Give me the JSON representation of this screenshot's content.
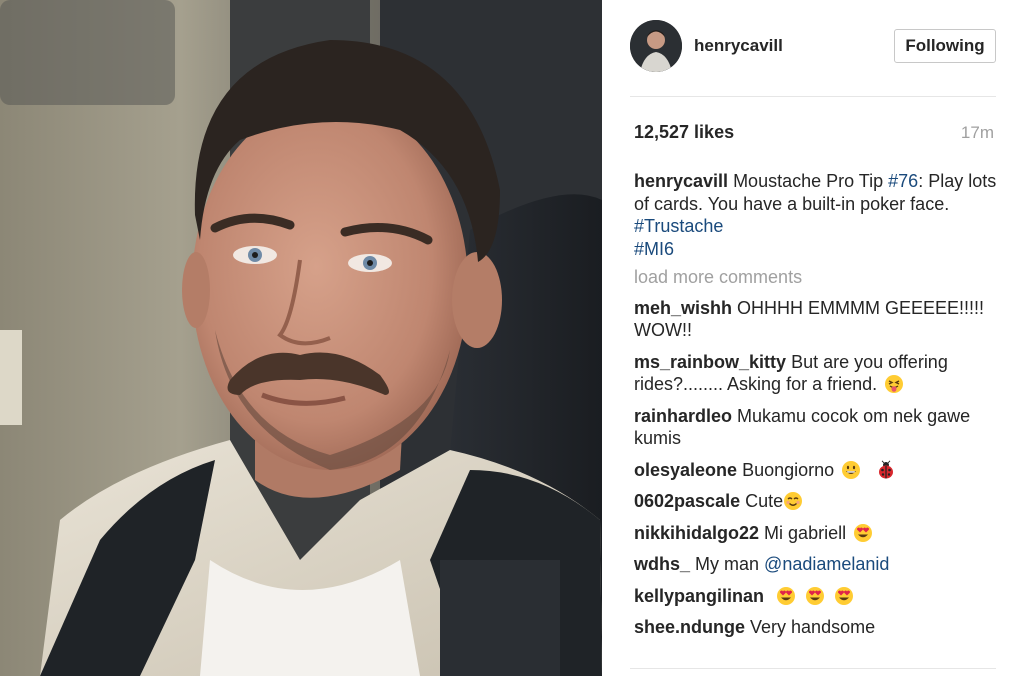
{
  "post": {
    "username": "henrycavill",
    "follow_label": "Following",
    "likes": "12,527 likes",
    "time": "17m",
    "caption": {
      "user": "henrycavill",
      "text_before": "Moustache Pro Tip ",
      "tag1": "#76",
      "text_after": ": Play lots of cards. You have a built-in poker face.",
      "tag2": "#Trustache",
      "tag3": "#MI6"
    },
    "load_more": "load more comments",
    "comments": [
      {
        "user": "meh_wishh",
        "text": "OHHHH EMMMM GEEEEE!!!!! WOW!!"
      },
      {
        "user": "ms_rainbow_kitty",
        "text": "But are you offering rides?........ Asking for a friend."
      },
      {
        "user": "rainhardleo",
        "text": "Mukamu cocok om nek gawe kumis"
      },
      {
        "user": "olesyaleone",
        "text": "Buongiorno"
      },
      {
        "user": "0602pascale",
        "text": "Cute"
      },
      {
        "user": "nikkihidalgo22",
        "text": "Mi gabriell"
      },
      {
        "user": "wdhs_",
        "text": "My man",
        "mention": "@nadiamelanid"
      },
      {
        "user": "kellypangilinan",
        "text": ""
      },
      {
        "user": "shee.ndunge",
        "text": "Very handsome"
      }
    ]
  },
  "colors": {
    "text": "#262626",
    "muted": "#a0a0a0",
    "hashtag": "#1a4a7c",
    "border": "#e6e6e6"
  },
  "icons": {
    "emoji_tongue": "winking-face-with-tongue",
    "emoji_grin": "grinning-face",
    "emoji_ladybug": "ladybug",
    "emoji_smile": "smiling-face",
    "emoji_hearteyes": "smiling-face-with-heart-eyes"
  }
}
